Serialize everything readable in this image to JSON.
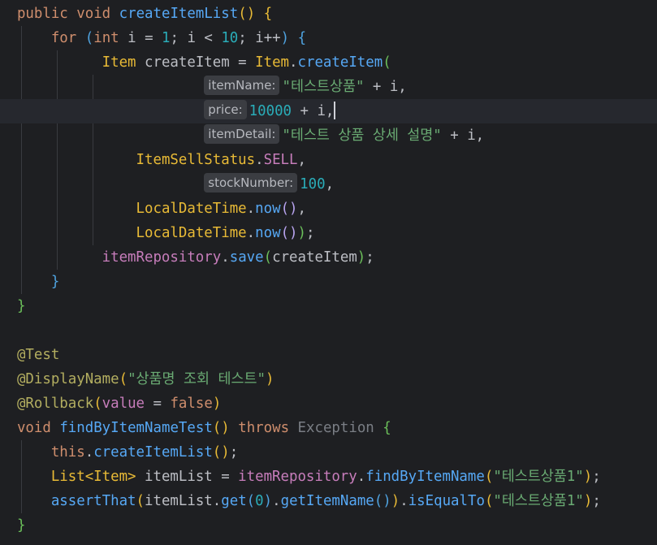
{
  "editor": {
    "m1": {
      "public": "public",
      "void": "void",
      "name": "createItemList",
      "open": "()",
      "brace": "{"
    },
    "for_line": {
      "for": "for",
      "lparen": "(",
      "int": "int",
      "i_eq": "i = ",
      "one": "1",
      "semi1": "; i < ",
      "ten": "10",
      "semi2": "; i++",
      "rparen": ")",
      "brace": "{"
    },
    "item_line": {
      "type": "Item",
      "var": "createItem = ",
      "cls": "Item",
      "dot": ".",
      "method": "createItem",
      "paren": "("
    },
    "arg1": {
      "hint": "itemName:",
      "str": "\"테스트상품\"",
      "rest": " + i,"
    },
    "arg2": {
      "hint": "price:",
      "num": "10000",
      "rest": " + i,"
    },
    "arg3": {
      "hint": "itemDetail:",
      "str": "\"테스트 상품 상세 설명\"",
      "rest": " + i,"
    },
    "arg4": {
      "cls": "ItemSellStatus",
      "dot": ".",
      "const": "SELL",
      "rest": ","
    },
    "arg5": {
      "hint": "stockNumber:",
      "num": "100",
      "rest": ","
    },
    "arg6": {
      "cls": "LocalDateTime",
      "dot": ".",
      "method": "now",
      "paren": "()",
      "rest": ","
    },
    "arg7": {
      "cls": "LocalDateTime",
      "dot": ".",
      "method": "now",
      "paren": "()",
      "close": ")",
      "rest": ";"
    },
    "save_line": {
      "field": "itemRepository",
      "dot": ".",
      "method": "save",
      "lparen": "(",
      "arg": "createItem",
      "rparen": ")",
      "rest": ";"
    },
    "close_for": "}",
    "close_m1": "}",
    "ann_test": "@Test",
    "ann_display": {
      "name": "@DisplayName",
      "lparen": "(",
      "str": "\"상품명 조회 테스트\"",
      "rparen": ")"
    },
    "ann_rollback": {
      "name": "@Rollback",
      "lparen": "(",
      "key": "value",
      "eq": " = ",
      "val": "false",
      "rparen": ")"
    },
    "m2": {
      "void": "void",
      "name": "findByItemNameTest",
      "paren": "()",
      "throws": "throws",
      "exc": "Exception",
      "brace": "{"
    },
    "call_line": {
      "this": "this",
      "dot": ".",
      "method": "createItemList",
      "paren": "()",
      "rest": ";"
    },
    "list_line": {
      "type": "List<Item>",
      "var": " itemList = ",
      "field": "itemRepository",
      "dot": ".",
      "method": "findByItemName",
      "lparen": "(",
      "str": "\"테스트상품1\"",
      "rparen": ")",
      "rest": ";"
    },
    "assert_line": {
      "method": "assertThat",
      "lparen": "(",
      "var": "itemList.",
      "get": "get",
      "gl": "(",
      "zero": "0",
      "gr": ")",
      "dot": ".",
      "getName": "getItemName",
      "gnp": "()",
      "rparen": ")",
      "dot2": ".",
      "eq": "isEqualTo",
      "el": "(",
      "str": "\"테스트상품1\"",
      "er": ")",
      "rest": ";"
    },
    "close_m2": "}"
  }
}
